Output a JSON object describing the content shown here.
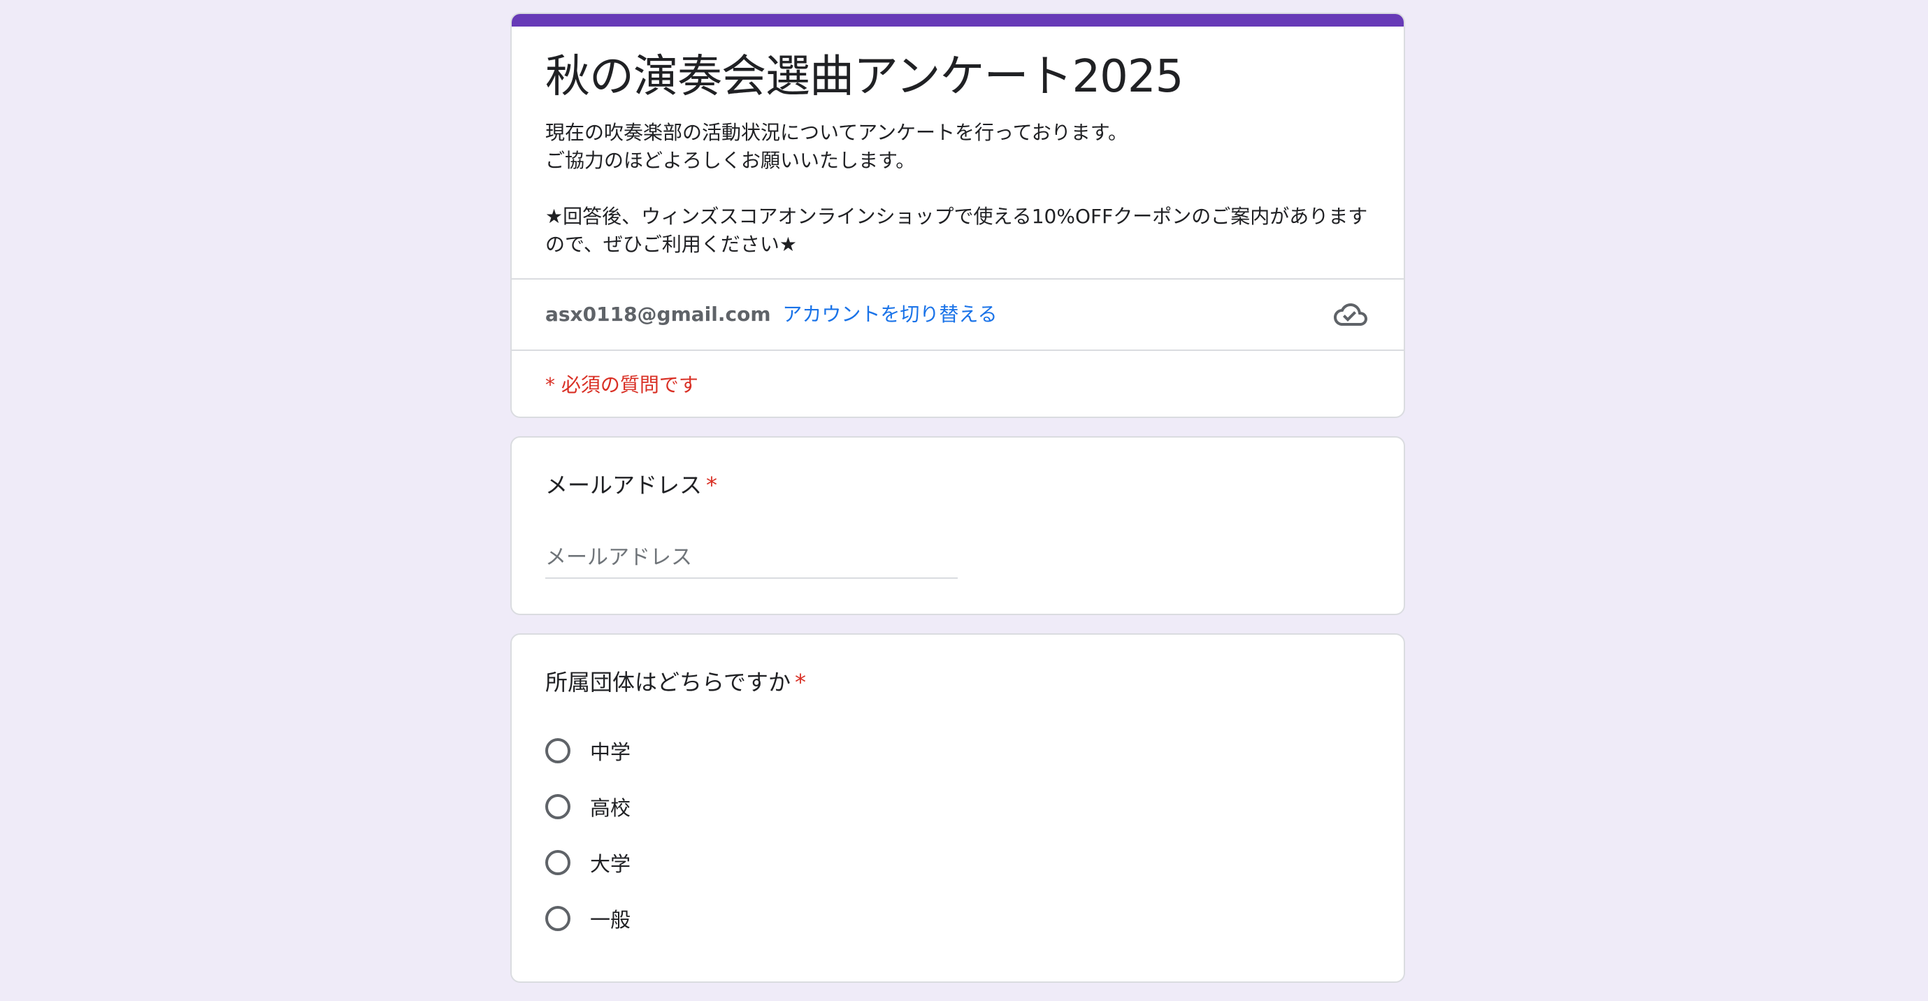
{
  "form": {
    "title": "秋の演奏会選曲アンケート2025",
    "description": "現在の吹奏楽部の活動状況についてアンケートを行っております。\nご協力のほどよろしくお願いいたします。\n\n★回答後、ウィンズスコアオンラインショップで使える10%OFFクーポンのご案内がありますので、ぜひご利用ください★",
    "accent_color": "#673ab7"
  },
  "account": {
    "email": "asx0118@gmail.com",
    "switch_label": "アカウントを切り替える",
    "status_icon": "cloud-done-icon"
  },
  "required_note": "* 必須の質問です",
  "questions": {
    "email": {
      "label": "メールアドレス",
      "required_mark": "*",
      "placeholder": "メールアドレス"
    },
    "affiliation": {
      "label": "所属団体はどちらですか",
      "required_mark": "*",
      "options": [
        "中学",
        "高校",
        "大学",
        "一般"
      ]
    }
  }
}
